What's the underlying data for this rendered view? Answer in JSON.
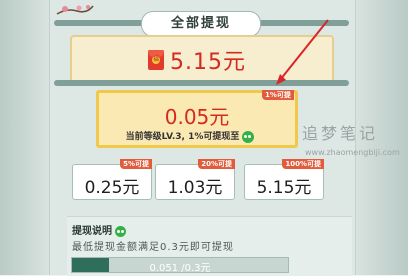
{
  "header": {
    "title": "全部提现"
  },
  "top_card": {
    "amount": "5.15元"
  },
  "current": {
    "amount": "0.05元",
    "badge": "1%可提",
    "level_text": "当前等级LV.3, 1%可提现至"
  },
  "tiers": [
    {
      "amount": "0.25元",
      "badge": "5%可提"
    },
    {
      "amount": "1.03元",
      "badge": "20%可提"
    },
    {
      "amount": "5.15元",
      "badge": "100%可提"
    }
  ],
  "explain": {
    "title": "提现说明",
    "text": "最低提现金额满足0.3元即可提现"
  },
  "progress": {
    "label": "0.051 /0.3元",
    "fraction": 0.17
  },
  "watermark": {
    "title": "追梦笔记",
    "url": "www.zhaomengbiji.com"
  },
  "colors": {
    "accent_red": "#d42a1e",
    "gold": "#f0c94a",
    "progress_fill": "#2f6e5a",
    "wechat_green": "#31b146"
  }
}
